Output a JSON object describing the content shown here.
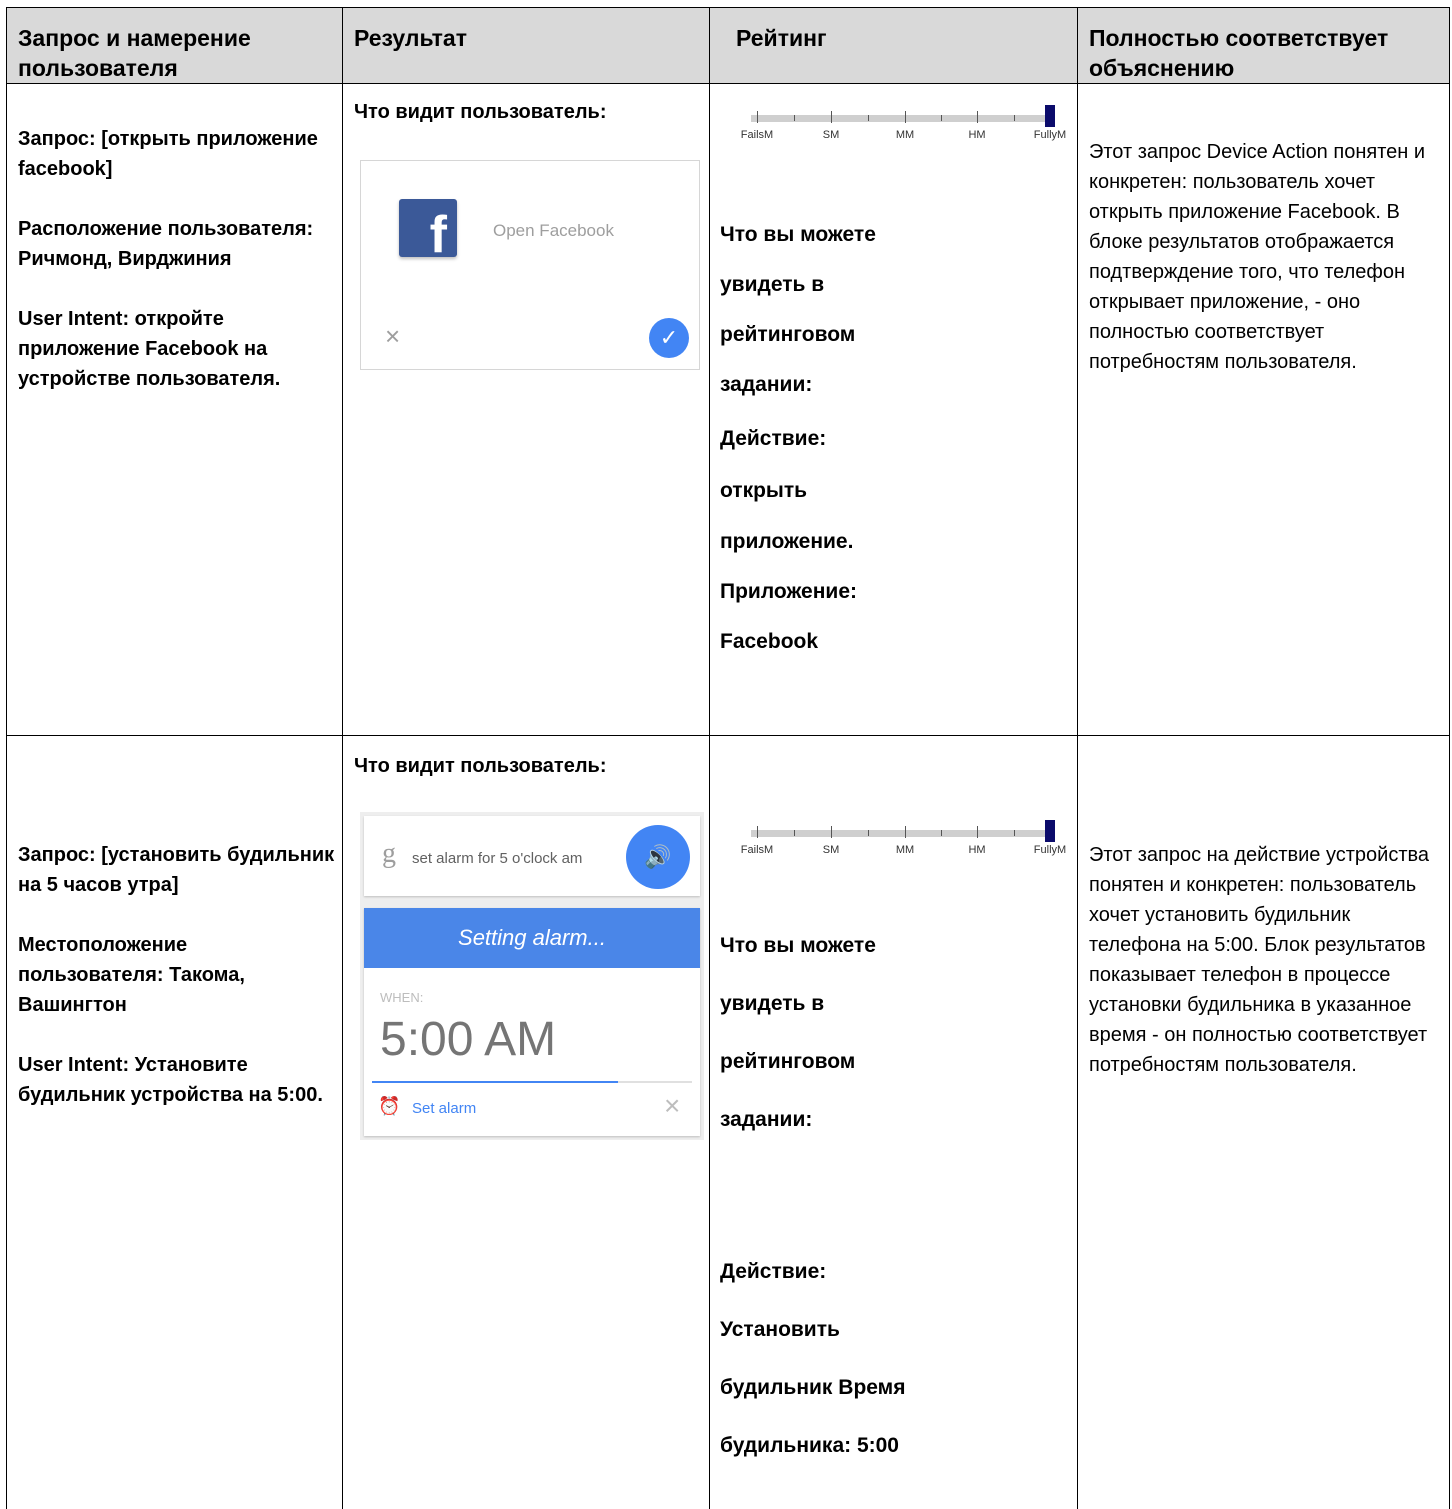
{
  "table": {
    "headers": [
      "Запрос и намерение пользователя",
      "Результат",
      "Рейтинг",
      "Полностью соответствует объяснению"
    ]
  },
  "rows": [
    {
      "query": "Запрос: [открыть приложение facebook]",
      "location": "Расположение пользователя: Ричмонд, Вирджиния",
      "intent": "User Intent: откройте приложение Facebook на устройстве пользователя.",
      "result_heading": "Что видит пользователь:",
      "card": {
        "icon": "facebook-icon",
        "icon_letter": "f",
        "text": "Open Facebook",
        "dismiss": "×",
        "confirm": "✓"
      },
      "rating": {
        "scale_labels": [
          "FailsM",
          "SM",
          "MM",
          "HM",
          "FullyM"
        ],
        "selected": "FullyM",
        "selected_fraction": 1.0,
        "lines": [
          "Что вы можете",
          "увидеть в",
          "рейтинговом",
          "задании:",
          "Действие:",
          "открыть",
          "приложение.",
          "Приложение:",
          "Facebook"
        ]
      },
      "explanation": "Этот запрос Device Action понятен и конкретен: пользователь хочет открыть приложение Facebook. В блоке результатов отображается подтверждение того, что телефон открывает приложение, - оно полностью соответствует потребностям пользователя."
    },
    {
      "query": "Запрос: [установить будильник на 5 часов утра]",
      "location": "Местоположение пользователя: Такома, Вашингтон",
      "intent": "User Intent: Установите будильник устройства на 5:00.",
      "result_heading": "Что видит пользователь:",
      "card": {
        "search_glyph": "g",
        "search_text": "set alarm for 5 o'clock am",
        "speaker": "🔊",
        "banner": "Setting alarm...",
        "when_label": "WHEN:",
        "time": "5:00 AM",
        "alarm_glyph": "⏰",
        "action": "Set alarm",
        "dismiss": "×",
        "progress": 0.77
      },
      "rating": {
        "scale_labels": [
          "FailsM",
          "SM",
          "MM",
          "HM",
          "FullyM"
        ],
        "selected": "FullyM",
        "selected_fraction": 1.0,
        "lines": [
          "Что вы можете",
          "увидеть в",
          "рейтинговом",
          "задании:",
          "",
          "Действие:",
          "Установить",
          "будильник Время",
          "будильника: 5:00"
        ]
      },
      "explanation": "Этот запрос на действие устройства понятен и конкретен: пользователь хочет установить будильник телефона на 5:00. Блок результатов показывает телефон в процессе установки будильника в указанное время - он полностью соответствует потребностям пользователя."
    }
  ]
}
